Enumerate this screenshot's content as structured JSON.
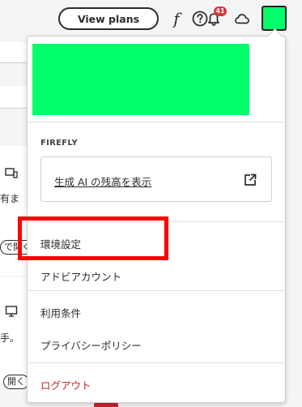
{
  "header": {
    "view_plans_label": "View plans",
    "fonts_icon_glyph": "f",
    "help_icon": "help-circle-icon",
    "notifications_icon": "bell-icon",
    "notification_count": "41",
    "cloud_icon": "cloud-icon",
    "avatar_color": "#00ff6a"
  },
  "background_fragments": {
    "text_1": "有ま",
    "pill_1": "で開く",
    "text_2": "手。",
    "pill_2": "開く"
  },
  "menu": {
    "profile_card_color": "#00ff6a",
    "section_label": "FIREFLY",
    "credits_link": "生成 AI の残高を表示",
    "credits_icon": "open-external-icon",
    "items": [
      {
        "label": "環境設定"
      },
      {
        "label": "アドビアカウント"
      },
      {
        "label": "利用条件"
      },
      {
        "label": "プライバシーポリシー"
      }
    ],
    "logout_label": "ログアウト"
  },
  "colors": {
    "highlight": "#ff0000",
    "logout": "#c9252d",
    "badge": "#d7373f"
  }
}
